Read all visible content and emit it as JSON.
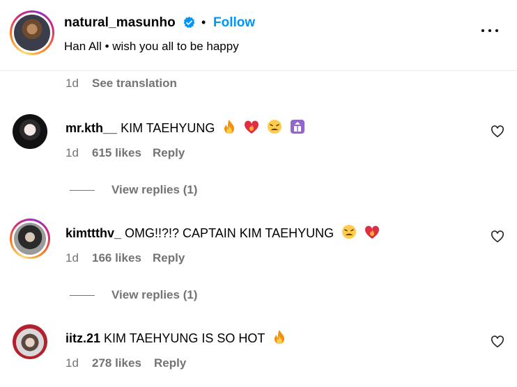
{
  "post": {
    "username": "natural_masunho",
    "follow_label": "Follow",
    "separator": "•",
    "subtitle": "Han All • wish you all to be happy",
    "time": "1d",
    "see_translation": "See translation"
  },
  "comments": [
    {
      "username": "mr.kth__",
      "text": "KIM TAEHYUNG",
      "emojis": [
        "fire-emoji",
        "heart-on-fire-emoji",
        "weary-face-emoji",
        "elevator-emoji"
      ],
      "time": "1d",
      "likes": "615 likes",
      "reply": "Reply",
      "view_replies": "View replies (1)"
    },
    {
      "username": "kimttthv_",
      "text": "OMG!!?!? CAPTAIN KIM TAEHYUNG",
      "emojis": [
        "weary-face-emoji",
        "heart-on-fire-emoji"
      ],
      "time": "1d",
      "likes": "166 likes",
      "reply": "Reply",
      "view_replies": "View replies (1)"
    },
    {
      "username": "iitz.21",
      "text": "KIM TAEHYUNG IS SO HOT",
      "emojis": [
        "fire-emoji"
      ],
      "time": "1d",
      "likes": "278 likes",
      "reply": "Reply"
    }
  ],
  "colors": {
    "link": "#0095f6",
    "muted": "#737373",
    "divider": "#efefef"
  }
}
